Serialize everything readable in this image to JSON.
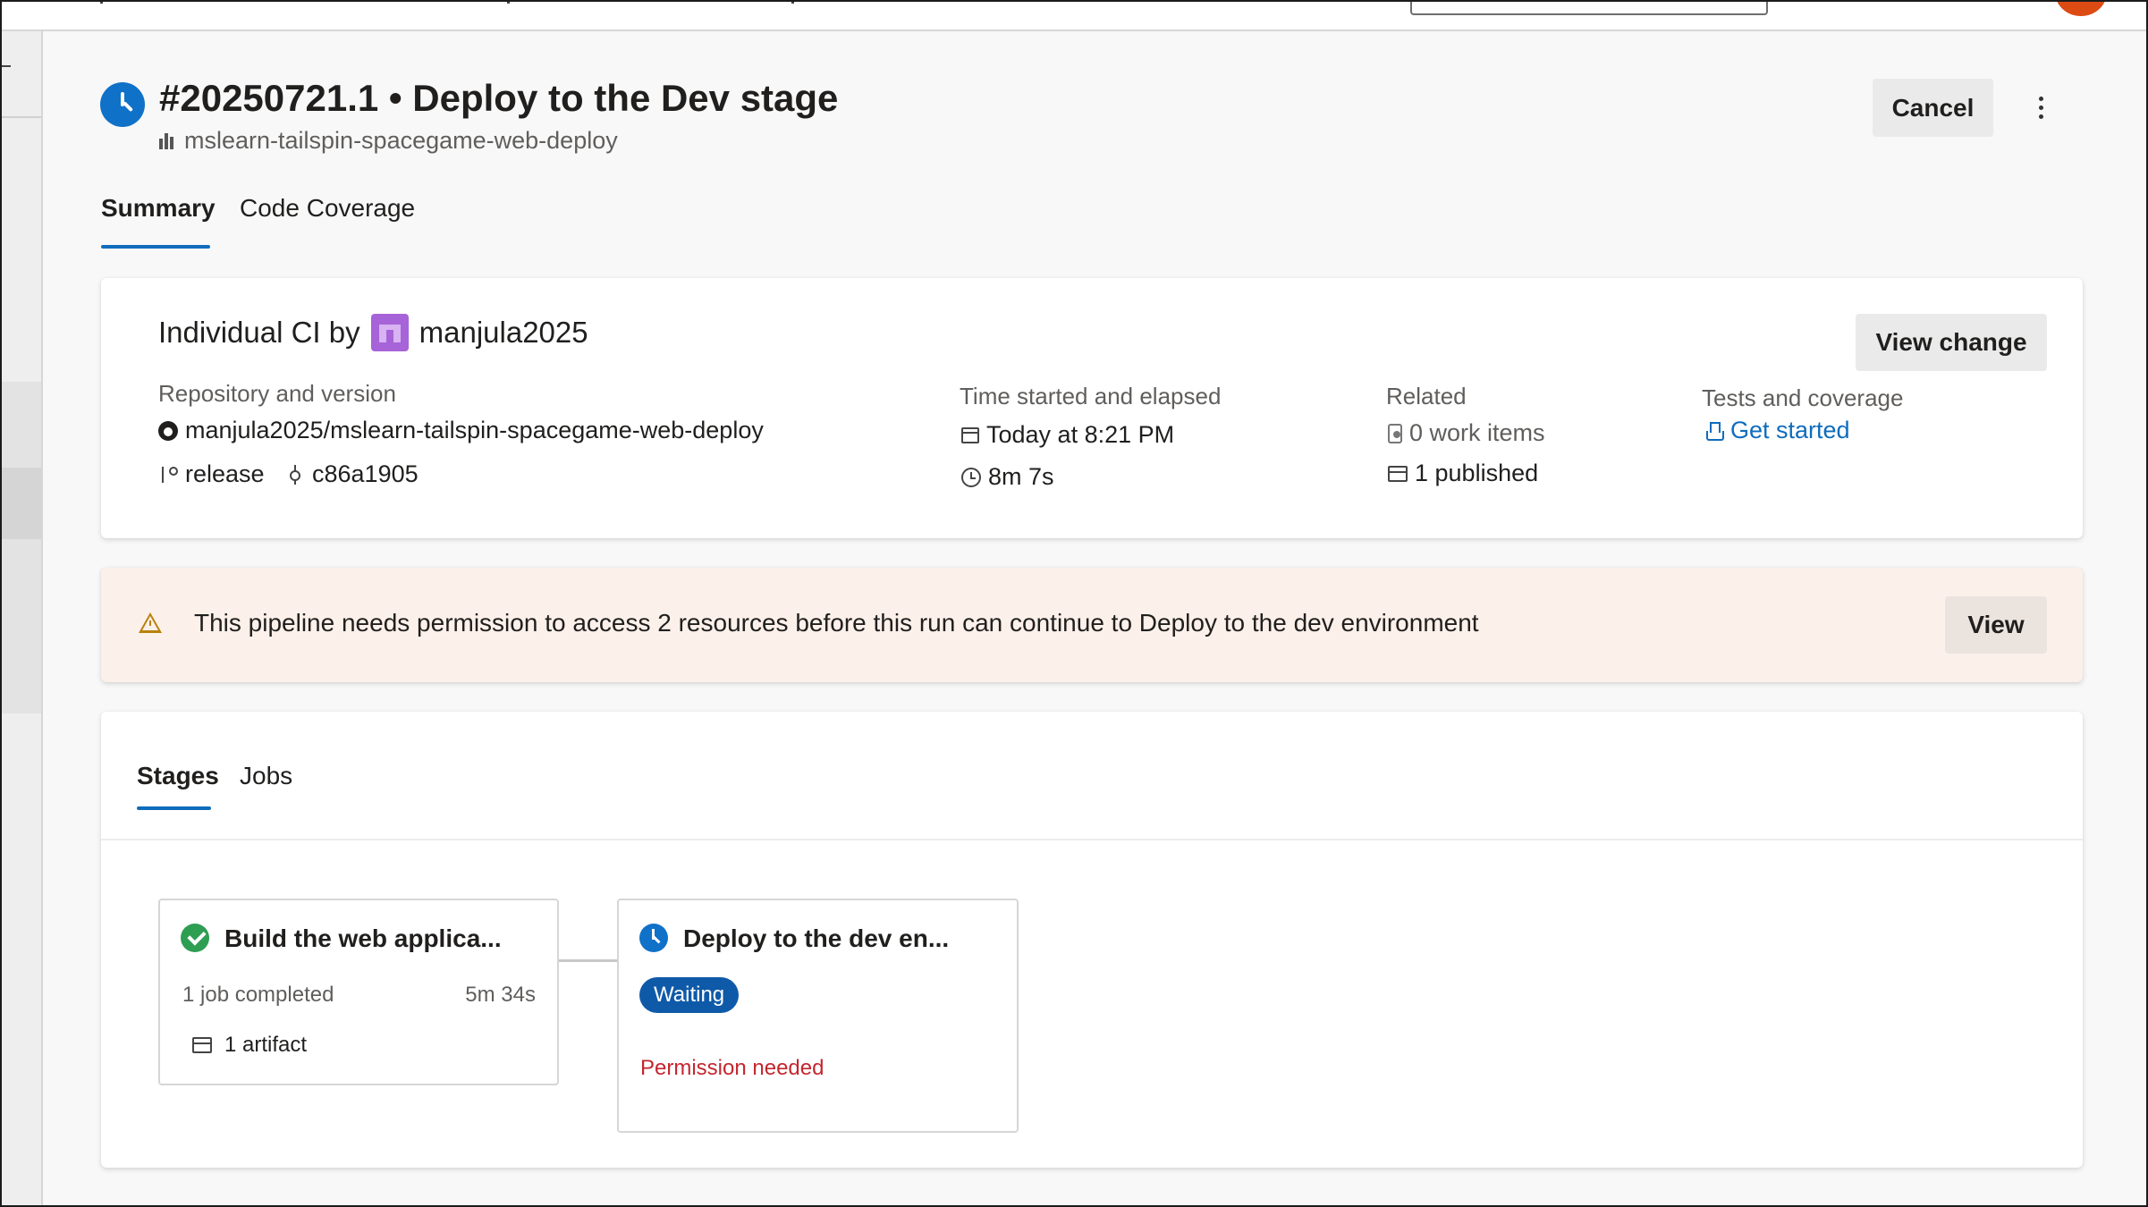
{
  "header": {
    "run_title": "#20250721.1 • Deploy to the Dev stage",
    "pipeline_name": "mslearn-tailspin-spacegame-web-deploy",
    "status_icon": "clock-icon",
    "cancel_label": "Cancel",
    "more_icon": "more-vertical-icon"
  },
  "tabs": [
    {
      "label": "Summary",
      "selected": true
    },
    {
      "label": "Code Coverage",
      "selected": false
    }
  ],
  "summary": {
    "trigger_prefix": "Individual CI by",
    "user": "manjula2025",
    "view_change_label": "View change",
    "repo_label": "Repository and version",
    "repo_name": "manjula2025/mslearn-tailspin-spacegame-web-deploy",
    "branch": "release",
    "commit": "c86a1905",
    "time_label": "Time started and elapsed",
    "started": "Today at 8:21 PM",
    "elapsed": "8m 7s",
    "related_label": "Related",
    "work_items": "0 work items",
    "published": "1 published",
    "tests_label": "Tests and coverage",
    "tests_link": "Get started"
  },
  "banner": {
    "icon": "warning-icon",
    "message": "This pipeline needs permission to access 2 resources before this run can continue to Deploy to the dev environment",
    "view_label": "View"
  },
  "stages_card": {
    "tabs": [
      {
        "label": "Stages",
        "selected": true
      },
      {
        "label": "Jobs",
        "selected": false
      }
    ],
    "stages": [
      {
        "title": "Build the web applica...",
        "status": "succeeded",
        "status_icon": "check-circle-icon",
        "jobs": "1 job completed",
        "duration": "5m 34s",
        "artifacts": "1 artifact"
      },
      {
        "title": "Deploy to the dev en...",
        "status_icon": "clock-icon",
        "badge": "Waiting",
        "note": "Permission needed"
      }
    ]
  },
  "colors": {
    "accent": "#0f6cbd",
    "success": "#2e9e52",
    "waiting_badge": "#0f5aa8",
    "error_text": "#c4262e",
    "warning_banner_bg": "#fcf0ea",
    "warning_icon": "#b8820a",
    "user_avatar": "#a763d8"
  }
}
